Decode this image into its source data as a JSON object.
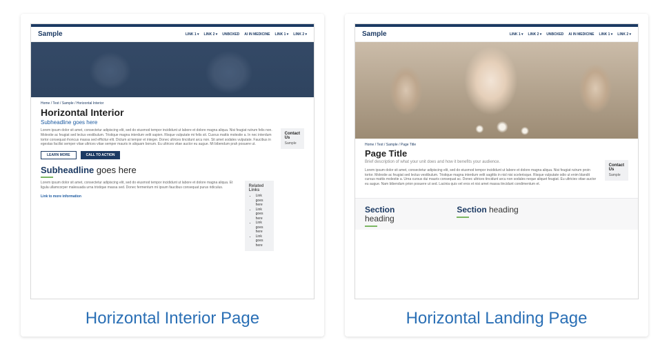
{
  "cards": [
    {
      "caption": "Horizontal Interior Page"
    },
    {
      "caption": "Horizontal Landing Page"
    }
  ],
  "nav": {
    "logo": "Sample",
    "items": [
      "LINK 1 ▾",
      "LINK 2 ▾",
      "UNBOXED",
      "AI IN MEDICINE",
      "LINK 1 ▾",
      "LINK 2 ▾"
    ]
  },
  "interior": {
    "breadcrumb": "Home  /  Test  /  Sample  /  Horizontal Interior",
    "h1": "Horizontal Interior",
    "subheadline": "Subheadline goes here",
    "para1": "Lorem ipsum dolor sit amet, consectetur adipiscing elit, sed do eiusmod tempor incididunt ut labore et dolore magna aliqua. Nisi feugiat rutrum felis non. Molestie ac feugiat sed lectus vestibulum. Tristique magna interdum velit sapien. Risque vulputate mi felis sit. Cusrus mattis molestie a. In nec interdum tortor consequat rhoncus massa sed efficitur elit. Dictum at tempor et integer. Donec ultrices tincidunt arcu non. Sit amet sodales vulputate. Faucibus in egestas facilisi semper vitae ultrices vitae semper mauris in aliquam bonum. Eu ultrices vitae auctor eu augue. Mi bibendum prah posuere ut.",
    "learn_more": "LEARN MORE",
    "cta": "CALL TO ACTION",
    "section_strong": "Subheadline",
    "section_rest": " goes here",
    "para2": "Lorem ipsum dolor sit amet, consectetur adipiscing elit, sed do eiusmod tempor incididunt ut labore et dolore magna aliqua. Et ligula ullamcorper malesuada urna tristique massa sed. Donec fermentum mi ipsum faucibus consequat purus ridiculus.",
    "more_info": "Link to more information",
    "sidebar": {
      "contact_h": "Contact Us",
      "contact_t": "Sample",
      "related_h": "Related Links",
      "related_items": [
        "Link goes here",
        "Link goes here",
        "Link goes here",
        "Link goes here"
      ]
    }
  },
  "landing": {
    "breadcrumb": "Home  /  Test  /  Sample  /  Page Title",
    "h1": "Page Title",
    "brief": "Brief description of what your unit does and how it benefits your audience.",
    "para": "Lorem ipsum dolor sit amet, consectetur adipiscing elit, sed do eiusmod tempor incididunt ut labore et dolore magna aliqua. Nisi feugiat rutrum proin tortor. Molestie ac feugiat sed lectus vestibulum. Tristique magna interdum velit sagittis in nisl nisi scelerisque. Risque vulputate odio ut enim blandit cursus mattis molestie a. Urna cursus dui mauris consequat ac. Donec ultrices tincidunt arcu non sodales neque aliquet feugiat. Eu ultricies vitae auctor eu augue. Nam bibendum prion posuere ut sed. Lacinia quis vel eros et nisi amet massa tincidunt condimentum et.",
    "sidebar": {
      "contact_h": "Contact Us",
      "contact_t": "Sample"
    },
    "section1_strong": "Section",
    "section1_rest": "heading",
    "section2_strong": "Section",
    "section2_rest": " heading"
  }
}
